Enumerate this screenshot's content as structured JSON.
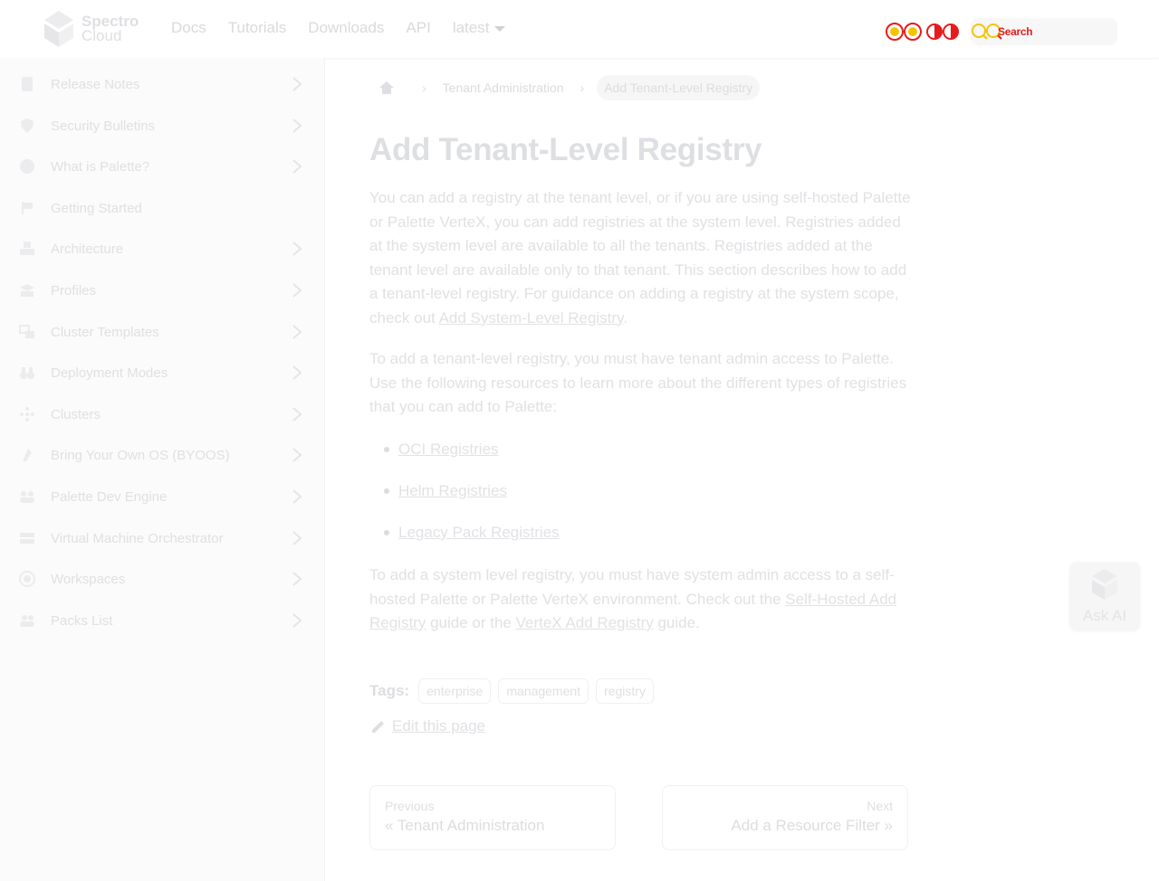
{
  "header": {
    "brand_line1": "Spectro",
    "brand_line2": "Cloud",
    "nav": [
      {
        "label": "Docs"
      },
      {
        "label": "Tutorials"
      },
      {
        "label": "Downloads"
      },
      {
        "label": "API"
      }
    ],
    "version_label": "latest",
    "search_placeholder": "Search"
  },
  "sidebar": {
    "items": [
      {
        "label": "Release Notes",
        "icon": "document-icon",
        "has_children": true
      },
      {
        "label": "Security Bulletins",
        "icon": "shield-icon",
        "has_children": true
      },
      {
        "label": "What is Palette?",
        "icon": "palette-icon",
        "has_children": true
      },
      {
        "label": "Getting Started",
        "icon": "flag-icon",
        "has_children": false
      },
      {
        "label": "Architecture",
        "icon": "cubes-icon",
        "has_children": true
      },
      {
        "label": "Profiles",
        "icon": "layers-icon",
        "has_children": true
      },
      {
        "label": "Cluster Templates",
        "icon": "templates-icon",
        "has_children": true
      },
      {
        "label": "Deployment Modes",
        "icon": "binoculars-icon",
        "has_children": true
      },
      {
        "label": "Clusters",
        "icon": "nodes-icon",
        "has_children": true
      },
      {
        "label": "Bring Your Own OS (BYOOS)",
        "icon": "os-icon",
        "has_children": true
      },
      {
        "label": "Palette Dev Engine",
        "icon": "users-icon",
        "has_children": true
      },
      {
        "label": "Virtual Machine Orchestrator",
        "icon": "server-icon",
        "has_children": true
      },
      {
        "label": "Workspaces",
        "icon": "globe-icon",
        "has_children": true
      },
      {
        "label": "Packs List",
        "icon": "people-icon",
        "has_children": true
      }
    ]
  },
  "breadcrumb": {
    "parent": "Tenant Administration",
    "current": "Add Tenant-Level Registry"
  },
  "content": {
    "title": "Add Tenant-Level Registry",
    "p1_text": "You can add a registry at the tenant level, or if you are using self-hosted Palette or Palette VerteX, you can add registries at the system level. Registries added at the system level are available to all the tenants. Registries added at the tenant level are available only to that tenant. This section describes how to add a tenant-level registry. For guidance on adding a registry at the system scope, check out ",
    "p1_link": "Add System-Level Registry",
    "p1_end": ".",
    "p2_text": "To add a tenant-level registry, you must have tenant admin access to Palette. Use the following resources to learn more about the different types of registries that you can add to Palette:",
    "bullets": [
      {
        "label": "OCI Registries"
      },
      {
        "label": "Helm Registries"
      },
      {
        "label": "Legacy Pack Registries"
      }
    ],
    "p4_text": "To add a system level registry, you must have system admin access to a self-hosted Palette or Palette VerteX environment. Check out the ",
    "p4_link1": "Self-Hosted Add Registry",
    "p4_mid": " guide or the ",
    "p4_link2": "VerteX Add Registry",
    "p4_end": " guide."
  },
  "tags": {
    "label": "Tags:",
    "items": [
      "enterprise",
      "management",
      "registry"
    ]
  },
  "edit_link": "Edit this page",
  "pager": {
    "prev_sub": "Previous",
    "prev_title": "« Tenant Administration",
    "next_sub": "Next",
    "next_title": "Add a Resource Filter »"
  },
  "ask_ai": {
    "label": "Ask AI"
  }
}
